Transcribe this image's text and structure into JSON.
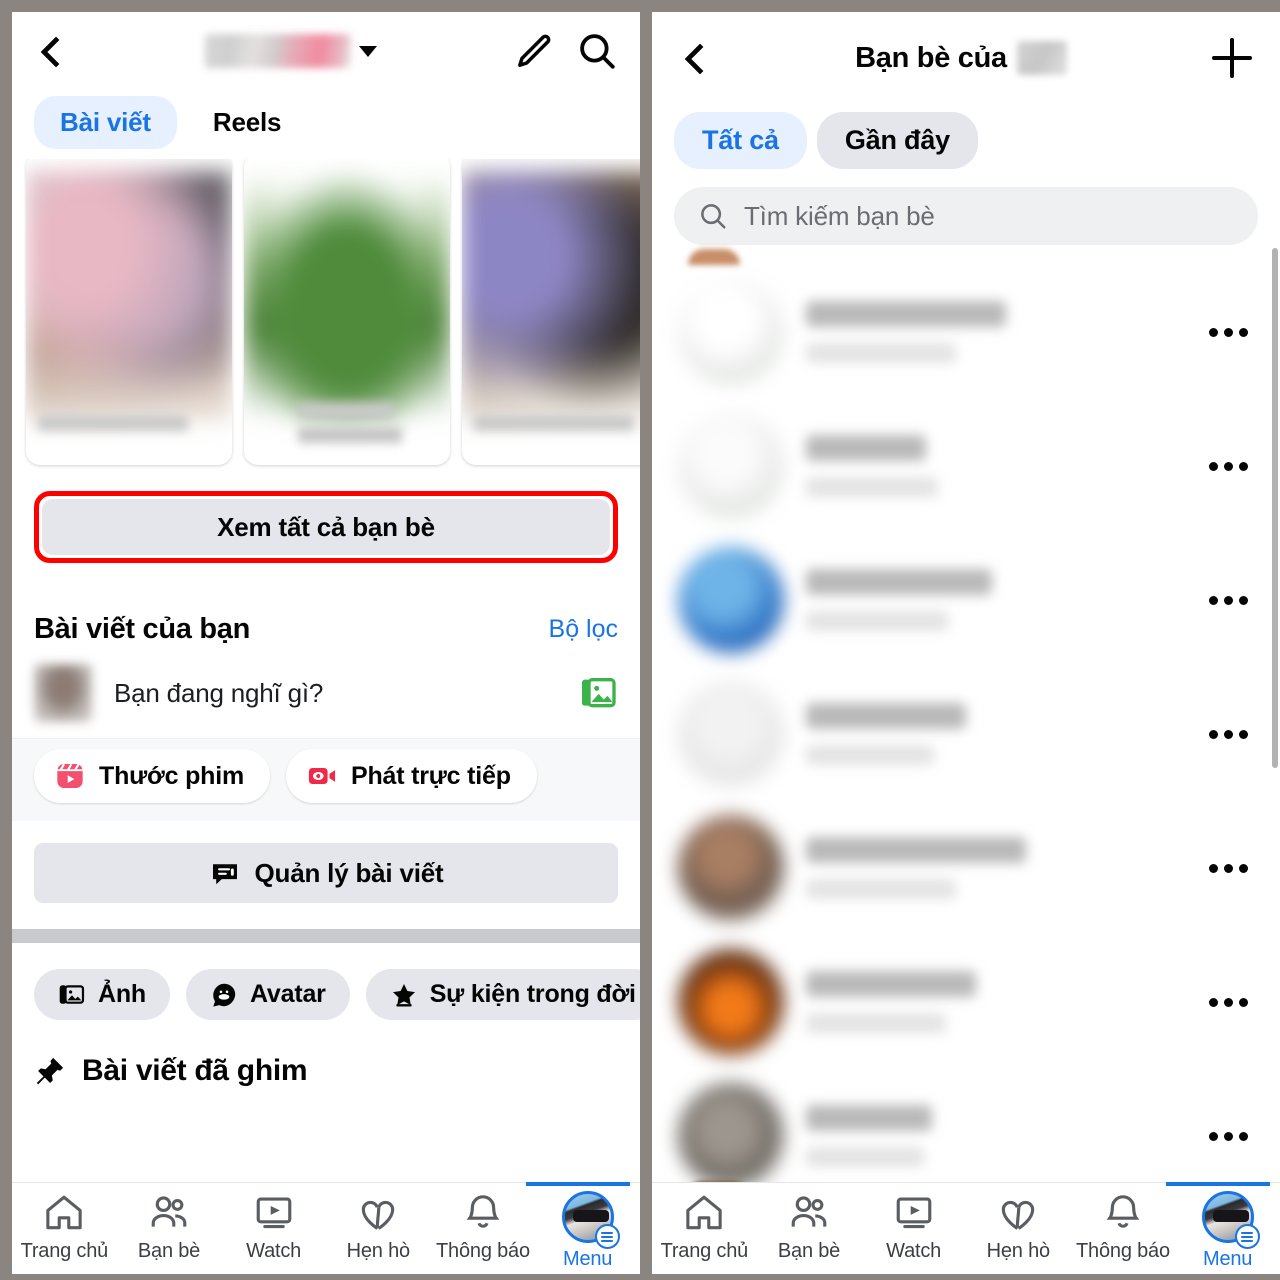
{
  "left": {
    "topbar": {
      "back_icon": "back-chevron-icon",
      "profile_name_redacted": "",
      "dropdown_icon": "caret-down-icon",
      "edit_icon": "pencil-icon",
      "search_icon": "search-icon"
    },
    "tabs": [
      {
        "label": "Bài viết",
        "active": true
      },
      {
        "label": "Reels",
        "active": false
      }
    ],
    "photo_cards": [
      {
        "caption_redacted": ""
      },
      {
        "caption_redacted": ""
      },
      {
        "caption_redacted": ""
      }
    ],
    "see_all_friends_button": "Xem tất cả bạn bè",
    "highlight_color": "#ff0000",
    "posts_section": {
      "title": "Bài viết của bạn",
      "filter_link": "Bộ lọc"
    },
    "composer": {
      "placeholder": "Bạn đang nghĩ gì?",
      "photo_icon": "photo-library-icon"
    },
    "quick_actions": [
      {
        "label": "Thước phim",
        "icon": "reels-icon"
      },
      {
        "label": "Phát trực tiếp",
        "icon": "live-video-icon"
      }
    ],
    "manage_posts_button": {
      "label": "Quản lý bài viết",
      "icon": "manage-posts-icon"
    },
    "chips": [
      {
        "label": "Ảnh",
        "icon": "photos-icon"
      },
      {
        "label": "Avatar",
        "icon": "avatar-icon"
      },
      {
        "label": "Sự kiện trong đời",
        "icon": "life-event-star-icon"
      }
    ],
    "pinned": {
      "label": "Bài viết đã ghim",
      "icon": "pin-icon"
    }
  },
  "right": {
    "topbar": {
      "back_icon": "back-chevron-icon",
      "title": "Bạn bè của",
      "name_redacted": "",
      "add_icon": "plus-icon"
    },
    "filters": [
      {
        "label": "Tất cả",
        "selected": true
      },
      {
        "label": "Gần đây",
        "selected": false
      }
    ],
    "search": {
      "placeholder": "Tìm kiếm bạn bè",
      "value": "",
      "icon": "search-icon"
    },
    "friends": [
      {
        "name_redacted": "",
        "subtitle_redacted": "",
        "menu_icon": "more-options-icon",
        "avatar_class": "av-g1"
      },
      {
        "name_redacted": "",
        "subtitle_redacted": "",
        "menu_icon": "more-options-icon",
        "avatar_class": "av-g2"
      },
      {
        "name_redacted": "",
        "subtitle_redacted": "",
        "menu_icon": "more-options-icon",
        "avatar_class": "av-g3"
      },
      {
        "name_redacted": "",
        "subtitle_redacted": "",
        "menu_icon": "more-options-icon",
        "avatar_class": "av-g4"
      },
      {
        "name_redacted": "",
        "subtitle_redacted": "",
        "menu_icon": "more-options-icon",
        "avatar_class": "av-g5"
      },
      {
        "name_redacted": "",
        "subtitle_redacted": "",
        "menu_icon": "more-options-icon",
        "avatar_class": "av-g6"
      },
      {
        "name_redacted": "",
        "subtitle_redacted": "",
        "menu_icon": "more-options-icon",
        "avatar_class": "av-g7"
      }
    ]
  },
  "bottom_nav": {
    "items": [
      {
        "label": "Trang chủ",
        "icon": "home-icon",
        "selected": false
      },
      {
        "label": "Bạn bè",
        "icon": "friends-icon",
        "selected": false
      },
      {
        "label": "Watch",
        "icon": "watch-play-icon",
        "selected": false
      },
      {
        "label": "Hẹn hò",
        "icon": "dating-hearts-icon",
        "selected": false
      },
      {
        "label": "Thông báo",
        "icon": "bell-icon",
        "selected": false
      },
      {
        "label": "Menu",
        "icon": "menu-avatar-icon",
        "selected": true
      }
    ],
    "active_color": "#1b74e4"
  }
}
